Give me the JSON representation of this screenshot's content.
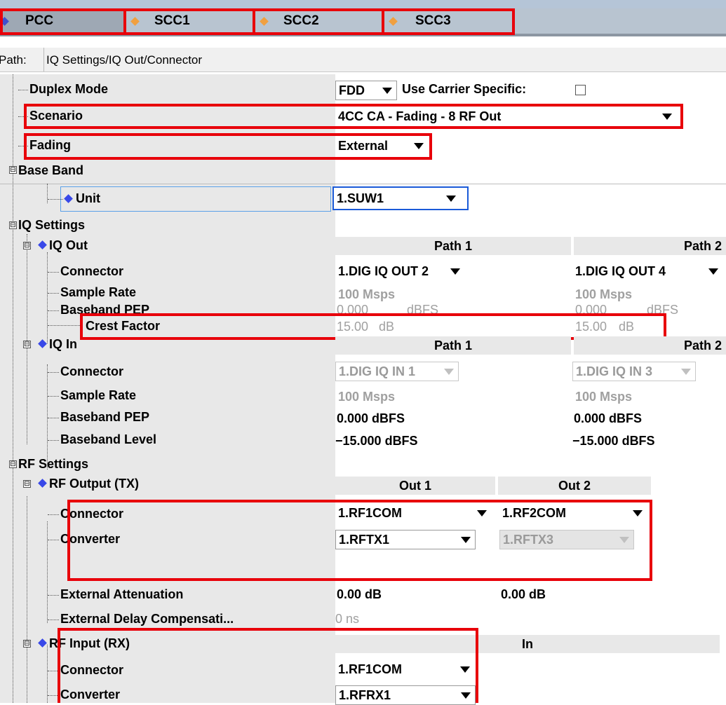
{
  "tabs": [
    "PCC",
    "SCC1",
    "SCC2",
    "SCC3"
  ],
  "path": {
    "label": "Path:",
    "value": "IQ Settings/IQ Out/Connector"
  },
  "rows": {
    "duplex_mode": {
      "label": "Duplex Mode",
      "value": "FDD",
      "carrier_label": "Use Carrier Specific:"
    },
    "scenario": {
      "label": "Scenario",
      "value": "4CC CA - Fading - 8 RF Out"
    },
    "fading": {
      "label": "Fading",
      "value": "External"
    },
    "base_band": {
      "label": "Base Band"
    },
    "unit": {
      "label": "Unit",
      "value": "1.SUW1"
    },
    "iq_settings": {
      "label": "IQ Settings"
    },
    "iq_out": {
      "label": "IQ Out",
      "headers": [
        "Path 1",
        "Path 2"
      ],
      "connector": {
        "label": "Connector",
        "values": [
          "1.DIG IQ OUT 2",
          "1.DIG IQ OUT 4"
        ]
      },
      "sample_rate": {
        "label": "Sample Rate",
        "values": [
          "100 Msps",
          "100 Msps"
        ]
      },
      "baseband_pep": {
        "label": "Baseband PEP",
        "values": [
          "0.000",
          "0.000"
        ],
        "unit": "dBFS"
      },
      "crest_factor": {
        "label": "Crest Factor",
        "values": [
          "15.00",
          "15.00"
        ],
        "unit": "dB"
      }
    },
    "iq_in": {
      "label": "IQ In",
      "headers": [
        "Path 1",
        "Path 2"
      ],
      "connector": {
        "label": "Connector",
        "values": [
          "1.DIG IQ IN 1",
          "1.DIG IQ IN 3"
        ]
      },
      "sample_rate": {
        "label": "Sample Rate",
        "values": [
          "100 Msps",
          "100 Msps"
        ]
      },
      "baseband_pep": {
        "label": "Baseband PEP",
        "values": [
          "0.000 dBFS",
          "0.000 dBFS"
        ]
      },
      "baseband_level": {
        "label": "Baseband Level",
        "values": [
          "−15.000 dBFS",
          "−15.000 dBFS"
        ]
      }
    },
    "rf_settings": {
      "label": "RF Settings"
    },
    "rf_output": {
      "label": "RF Output (TX)",
      "headers": [
        "Out 1",
        "Out 2"
      ],
      "connector": {
        "label": "Connector",
        "values": [
          "1.RF1COM",
          "1.RF2COM"
        ]
      },
      "converter": {
        "label": "Converter",
        "values": [
          "1.RFTX1",
          "1.RFTX3"
        ]
      },
      "ext_attenuation": {
        "label": "External Attenuation",
        "values": [
          "0.00 dB",
          "0.00 dB"
        ]
      },
      "ext_delay": {
        "label": "External Delay Compensati...",
        "value": "0 ns"
      }
    },
    "rf_input": {
      "label": "RF Input (RX)",
      "header": "In",
      "connector": {
        "label": "Connector",
        "value": "1.RF1COM"
      },
      "converter": {
        "label": "Converter",
        "value": "1.RFRX1"
      }
    }
  },
  "colors": {
    "highlight_box": "#e8000a",
    "tab_dot": "#f0a040",
    "active_marker": "#3848e8"
  },
  "icons": {
    "expander": "tree-expander-icon",
    "dropdown": "dropdown-arrow-icon",
    "diamond": "diamond-marker-icon"
  }
}
